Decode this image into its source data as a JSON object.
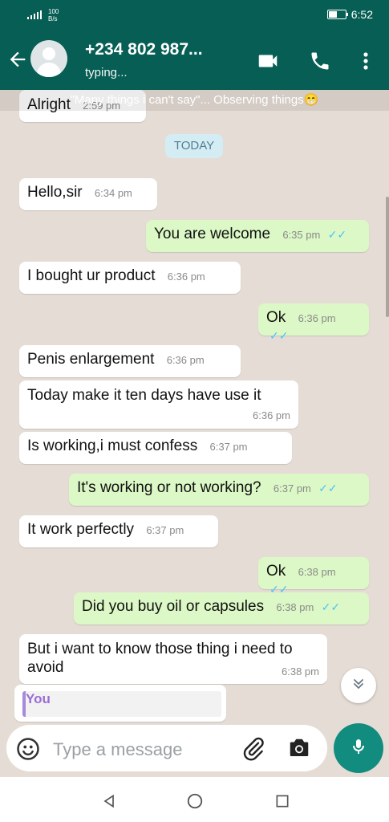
{
  "status_bar": {
    "network_speed": "100\nB/s",
    "time": "6:52"
  },
  "header": {
    "title": "+234 802 987...",
    "subtitle": "typing..."
  },
  "banner_text": "\"Many things i can't say\"... Observing things😁",
  "date_label": "TODAY",
  "messages": [
    {
      "side": "in",
      "text": "Alright",
      "time": "2:59 pm"
    },
    {
      "side": "in",
      "text": "Hello,sir",
      "time": "6:34 pm"
    },
    {
      "side": "out",
      "text": "You are welcome",
      "time": "6:35 pm"
    },
    {
      "side": "in",
      "text": "I bought ur product",
      "time": "6:36 pm"
    },
    {
      "side": "out",
      "text": "Ok",
      "time": "6:36 pm"
    },
    {
      "side": "in",
      "text": "Penis enlargement",
      "time": "6:36 pm"
    },
    {
      "side": "in",
      "text": "Today make it ten days have use it",
      "time": "6:36 pm"
    },
    {
      "side": "in",
      "text": "Is working,i must confess",
      "time": "6:37 pm"
    },
    {
      "side": "out",
      "text": "It's working or not working?",
      "time": "6:37 pm"
    },
    {
      "side": "in",
      "text": "It work perfectly",
      "time": "6:37 pm"
    },
    {
      "side": "out",
      "text": "Ok",
      "time": "6:38 pm"
    },
    {
      "side": "out",
      "text": "Did you buy oil or capsules",
      "time": "6:38 pm"
    },
    {
      "side": "in",
      "text": "But i want to know those thing i need to avoid",
      "time": "6:38 pm"
    }
  ],
  "quoted_name": "You",
  "composer": {
    "placeholder": "Type a message"
  },
  "icons": {
    "read_ticks": "double-check-icon"
  }
}
